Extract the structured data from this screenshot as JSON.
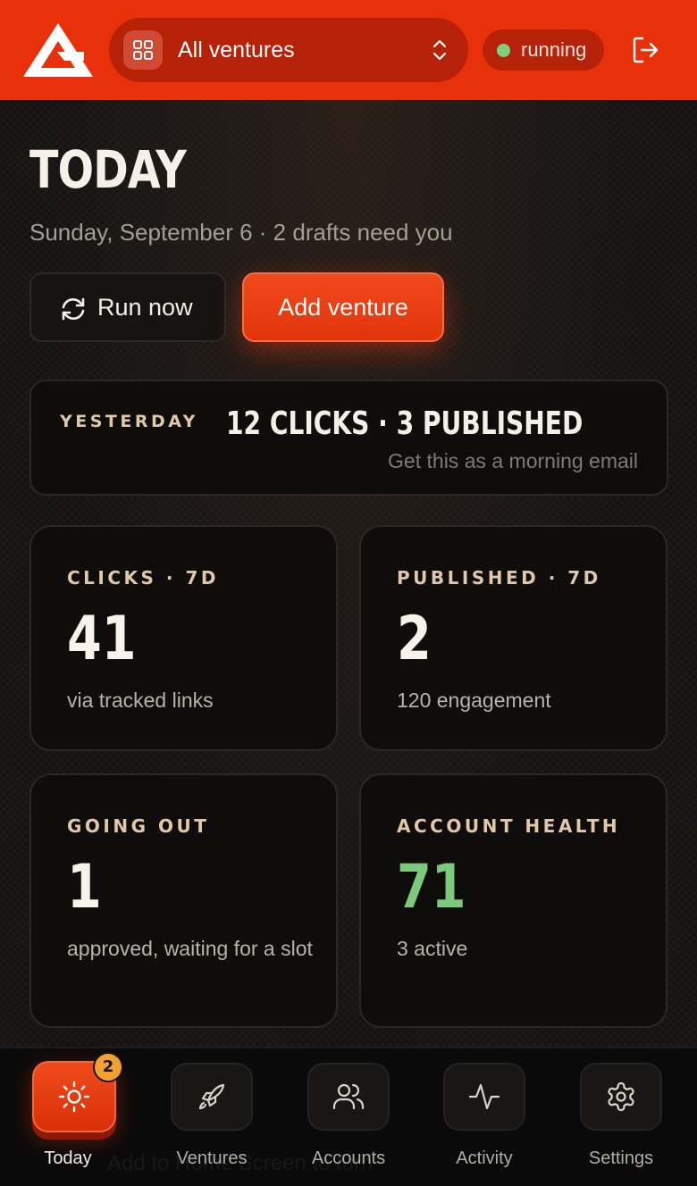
{
  "header": {
    "venture_selector": "All ventures",
    "status": "running",
    "colors": {
      "brand": "#e8300a",
      "status_dot": "#7ed07e"
    }
  },
  "page": {
    "title": "TODAY",
    "subtitle": "Sunday, September 6 · 2 drafts need you"
  },
  "actions": {
    "run_now": "Run now",
    "add_venture": "Add venture"
  },
  "yesterday": {
    "tag": "YESTERDAY",
    "headline": "12 CLICKS · 3 PUBLISHED",
    "note": "Get this as a morning email"
  },
  "stats": [
    {
      "label": "CLICKS · 7D",
      "value": "41",
      "desc": "via tracked links"
    },
    {
      "label": "PUBLISHED · 7D",
      "value": "2",
      "desc": "120 engagement"
    },
    {
      "label": "GOING OUT",
      "value": "1",
      "desc": "approved, waiting for a slot"
    },
    {
      "label": "ACCOUNT HEALTH",
      "value": "71",
      "desc": "3 active",
      "value_color": "#7cc97b"
    }
  ],
  "nav": [
    {
      "label": "Today",
      "icon": "sun-icon",
      "badge": "2",
      "active": true
    },
    {
      "label": "Ventures",
      "icon": "rocket-icon"
    },
    {
      "label": "Accounts",
      "icon": "users-icon"
    },
    {
      "label": "Activity",
      "icon": "activity-icon"
    },
    {
      "label": "Settings",
      "icon": "gear-icon"
    }
  ],
  "ghost_text": "Add to Home Screen to turn"
}
